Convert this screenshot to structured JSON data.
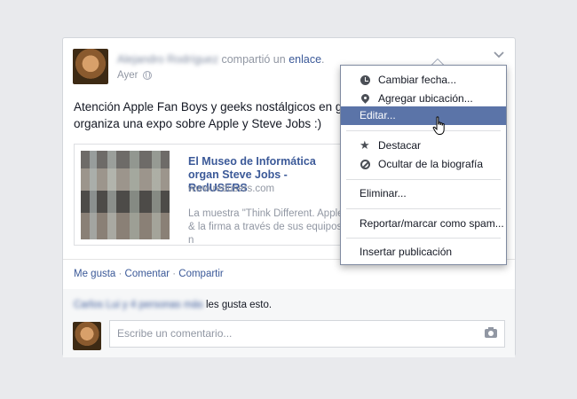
{
  "post": {
    "author_blurred": "Alejandro Rodríguez",
    "shared_text": "compartió un",
    "shared_link": "enlace",
    "shared_end": ".",
    "time": "Ayer",
    "text_line1": "Atención Apple Fan Boys y geeks nostálgicos en gene",
    "text_line2": "organiza una expo sobre Apple y Steve Jobs :)"
  },
  "attachment": {
    "title": "El Museo de Informática organ Steve Jobs - RedUSERS",
    "url": "www.redusers.com",
    "description": "La muestra \"Think Different. Apple & la firma a través de sus equipos n"
  },
  "actions": {
    "like": "Me gusta",
    "comment": "Comentar",
    "share": "Compartir",
    "sep": " · "
  },
  "likes": {
    "names_blurred": "Carlos Lui y 4 personas más",
    "suffix": "les gusta esto."
  },
  "comment_box": {
    "placeholder": "Escribe un comentario..."
  },
  "menu": {
    "change_date": "Cambiar fecha...",
    "add_location": "Agregar ubicación...",
    "edit": "Editar...",
    "highlight": "Destacar",
    "hide_timeline": "Ocultar de la biografía",
    "delete": "Eliminar...",
    "report_spam": "Reportar/marcar como spam...",
    "embed": "Insertar publicación"
  },
  "icons": {
    "globe": "globe-icon",
    "chevron": "chevron-down-icon",
    "clock": "clock-icon",
    "pin": "location-pin-icon",
    "star": "star-icon",
    "block": "block-icon",
    "camera": "camera-icon",
    "cursor": "hand-cursor-icon"
  },
  "colors": {
    "link": "#3b5998",
    "menu_highlight": "#5b74a8",
    "background": "#e9eaed"
  }
}
